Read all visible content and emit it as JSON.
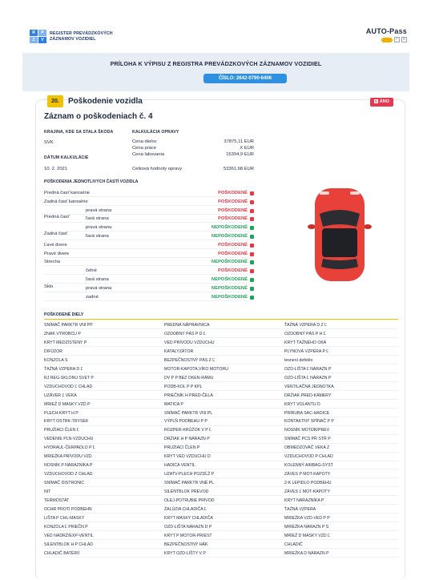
{
  "header": {
    "logo_marks": [
      "R",
      "P",
      "Z",
      "V"
    ],
    "logo_line1": "REGISTER PREVÁDZKOVÝCH",
    "logo_line2": "ZÁZNAMOV VOZIDIEL",
    "autopass_title": "AUTO-Pass"
  },
  "banner": {
    "title": "PRÍLOHA K VÝPISU Z REGISTRA PREVÁDZKOVÝCH ZÁZNAMOV VOZIDIEL",
    "document_number": "ČÍSLO: 2642-0790-6406"
  },
  "section": {
    "number": "20.",
    "title": "Poškodenie vozidla",
    "badge": "ÁNO",
    "record_title": "Záznam o poškodeniach č. 4"
  },
  "info": {
    "country_label": "KRAJINA, KDE SA STALA ŠKODA",
    "country_value": "SVK",
    "date_label": "DÁTUM KALKULÁCIE",
    "date_value": "10. 2. 2021",
    "calc_label": "KALKULÁCIA OPRAVY",
    "calc_rows": [
      {
        "label": "Cena dielov",
        "value": "37875,11 EUR"
      },
      {
        "label": "Cena práce",
        "value": "X EUR"
      },
      {
        "label": "Cena lakovania",
        "value": "15394,9 EUR"
      }
    ],
    "total_label": "Celková hodnoty opravy",
    "total_value": "53361,68 EUR"
  },
  "parts": {
    "heading": "POŠKODENIA JEDNOTLIVÝCH ČASTÍ VOZIDLA",
    "groups": [
      "Predná časť",
      "Zadná časť",
      "Sklo"
    ],
    "rows": [
      {
        "c1": "Predná časť karosérie",
        "c2": "",
        "status": "POŠKODENÉ",
        "ok": false
      },
      {
        "c1": "Zadná časť karosérie",
        "c2": "",
        "status": "POŠKODENÉ",
        "ok": false
      },
      {
        "c1": "",
        "c2": "pravá strana",
        "status": "POŠKODENÉ",
        "ok": false
      },
      {
        "c1": "",
        "c2": "ľavá strana",
        "status": "POŠKODENÉ",
        "ok": false
      },
      {
        "c1": "",
        "c2": "pravá strana",
        "status": "NEPOŠKODENÉ",
        "ok": true
      },
      {
        "c1": "",
        "c2": "ľavá strana",
        "status": "NEPOŠKODENÉ",
        "ok": true
      },
      {
        "c1": "Ľavé dvere",
        "c2": "",
        "status": "POŠKODENÉ",
        "ok": false
      },
      {
        "c1": "Pravé dvere",
        "c2": "",
        "status": "POŠKODENÉ",
        "ok": false
      },
      {
        "c1": "Strecha",
        "c2": "",
        "status": "NEPOŠKODENÉ",
        "ok": true
      },
      {
        "c1": "",
        "c2": "čelné",
        "status": "POŠKODENÉ",
        "ok": false
      },
      {
        "c1": "",
        "c2": "ľavá strana",
        "status": "NEPOŠKODENÉ",
        "ok": true
      },
      {
        "c1": "",
        "c2": "pravá strana",
        "status": "NEPOŠKODENÉ",
        "ok": true
      },
      {
        "c1": "",
        "c2": "zadné",
        "status": "NEPOŠKODENÉ",
        "ok": true
      }
    ]
  },
  "colors": {
    "damaged": "#e63946",
    "undamaged": "#22a35a",
    "accent": "#f2c200",
    "car": "#e8413a"
  },
  "diely": {
    "heading": "POŠKODENÉ DIELY",
    "rows": [
      [
        "SNÍMAČ PARKTR VNI PP",
        "PREDNÁ NÁPRAVNICA",
        "ŤAŽNÁ VZPERA D Z Ľ"
      ],
      [
        "ZNAK VÝROBCU P",
        "OZDOBNÝ PÁS P D Ľ",
        "OZDOBNÝ PÁS P H Ľ"
      ],
      [
        "KRYT MEDZISTENY P",
        "VED PRÍVODU VZDUCHU",
        "KRYT ŤAŽNÉHO OKA"
      ],
      [
        "DIFÚZOR",
        "KATALYZÁTOR",
        "PLYNOVÁ VZPERA P Ľ"
      ],
      [
        "KONZOLA S",
        "BEZPEČNOSTNÝ PÁS Z Ľ",
        "tesnení defekto"
      ],
      [
        "ŤAŽNÁ VZPERA D Ľ",
        "MOTOR-KAPOTA,VÍKO MOTORU",
        "OZD-LIŠTA Ľ NÁRAZN P"
      ],
      [
        "RJ REG-SKLONU SVET P",
        "DV P P BEZ OKEN-RÁMU",
        "OZD-LIŠTA Ľ NÁRAZN P"
      ],
      [
        "VZDUCHOVOD Ľ CHLAD",
        "PODB-KOL P P KPL",
        "VENTILAČNÁ JEDNOTKA"
      ],
      [
        "UZÁVER Ľ VEKA",
        "PRIEČNÍK H PRED-ČELA",
        "DRŽIAK PRED-KAMERY"
      ],
      [
        "MRIEŽ D MASKY VZD P",
        "MATICA P",
        "KRYT VOLANTU D"
      ],
      [
        "PLECH-KRYT H P",
        "SNÍMAČ PARKTR VNI PL",
        "PRÍRUBA SAC-HADICE"
      ],
      [
        "KRYT OSTRK-TRYSEK",
        "VÝPLŇ PODBEHU P P",
        "KONTAKTNÝ SPÍNAČ P P"
      ],
      [
        "PRUŽIACI ČLEN Ľ",
        "ROZPER-KRÚŽOK V P Ľ",
        "NOSNÍK MOTOR/PREV"
      ],
      [
        "VEDENIE PLN-VZDUCHU",
        "DRŽIAK H P NÁRAZN P",
        "SNÍMAČ PCS PŘ STŘ P"
      ],
      [
        "HYDRAUL-ČERPADLO P Ľ",
        "PRUŽIACI ČLEN P",
        "OBMEDZOVAČ VEKA Z"
      ],
      [
        "MRIEŽKA PRÍVODU VZD",
        "KRYT VED VZDUCHU D",
        "VZDUCHOVOD P CHLAD"
      ],
      [
        "NOSNÍK P NÁRAZNÍKA P",
        "HADICA VENTIL",
        "KOLENNÝ AIRBAG-SYST"
      ],
      [
        "VZDUCHOVOD Z CHLAD",
        "UZATV-PLECH POZDĹŽ P",
        "ZÁVES P MOT-KAPOTY"
      ],
      [
        "SNÍMAČ DISTRONIC",
        "SNÍMAČ PARKTR VNĚ PL",
        "2-K LEPIDLO PODBEHU"
      ],
      [
        "NIT",
        "SILENTBLOK PREVOD",
        "ZÁVES Ľ MOT-KAPOTY"
      ],
      [
        "TERMOSTAT",
        "OLEJ-POTRUBIE PRÍVOD",
        "KRYT NÁRAZNÍKA P"
      ],
      [
        "OCHR PROTI PODBEHN",
        "ŽALÚZIA CHLADIČA Ľ",
        "ŤAŽNÁ VZPERA"
      ],
      [
        "LIŠTA P CHL-MASKY",
        "KRYT MASKY CHLADIČA",
        "MRIEŽKA VZD-VED P P"
      ],
      [
        "KONZOLA Ľ PRIEČN P",
        "OZD-LIŠTA NÁRAZN D P",
        "MRIEŽKA NÁRAZN P S"
      ],
      [
        "VED NADRŽ/EXP-VENTIL",
        "KRYT P MOTOR-PRIEST",
        "MRIEŽ D MASKY VZD Ľ"
      ],
      [
        "SILENTBLOK H P CHLAD",
        "BEZPEČNOSTNÝ HÁK",
        "CHLADIČ"
      ],
      [
        "CHLADIČ BATÉRIÍ",
        "KRYT OZD-LIŠTY V P",
        "MRIEŽKA D NÁRAZN P"
      ]
    ]
  }
}
